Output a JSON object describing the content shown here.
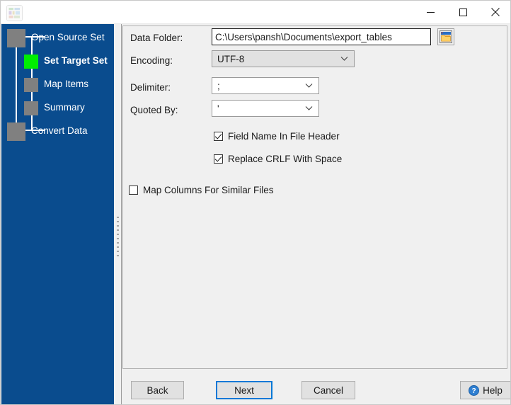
{
  "window": {
    "title": "",
    "app_icon": "table-grid-icon",
    "controls": {
      "minimize": "minimize-icon",
      "maximize": "maximize-icon",
      "close": "close-icon"
    }
  },
  "sidebar": {
    "accent_color": "#0a4c8e",
    "active_color": "#00ee00",
    "node_color": "#808080",
    "steps": [
      {
        "label": "Open Source Set",
        "state": "done",
        "node": "big"
      },
      {
        "label": "Set Target Set",
        "state": "active",
        "node": "small"
      },
      {
        "label": "Map Items",
        "state": "pending",
        "node": "small"
      },
      {
        "label": "Summary",
        "state": "pending",
        "node": "small"
      },
      {
        "label": "Convert Data",
        "state": "pending",
        "node": "big"
      }
    ]
  },
  "form": {
    "data_folder": {
      "label": "Data Folder:",
      "value": "C:\\Users\\pansh\\Documents\\export_tables",
      "browse_icon": "folder-open-icon"
    },
    "encoding": {
      "label": "Encoding:",
      "value": "UTF-8"
    },
    "delimiter": {
      "label": "Delimiter:",
      "value": ";"
    },
    "quoted_by": {
      "label": "Quoted By:",
      "value": "'"
    },
    "checkboxes": [
      {
        "label": "Field Name In File Header",
        "checked": true
      },
      {
        "label": "Replace CRLF With Space",
        "checked": true
      },
      {
        "label": "Map Columns For Similar Files",
        "checked": false
      }
    ]
  },
  "buttons": {
    "back": "Back",
    "next": "Next",
    "cancel": "Cancel",
    "help": "Help",
    "help_icon": "question-circle-icon"
  }
}
